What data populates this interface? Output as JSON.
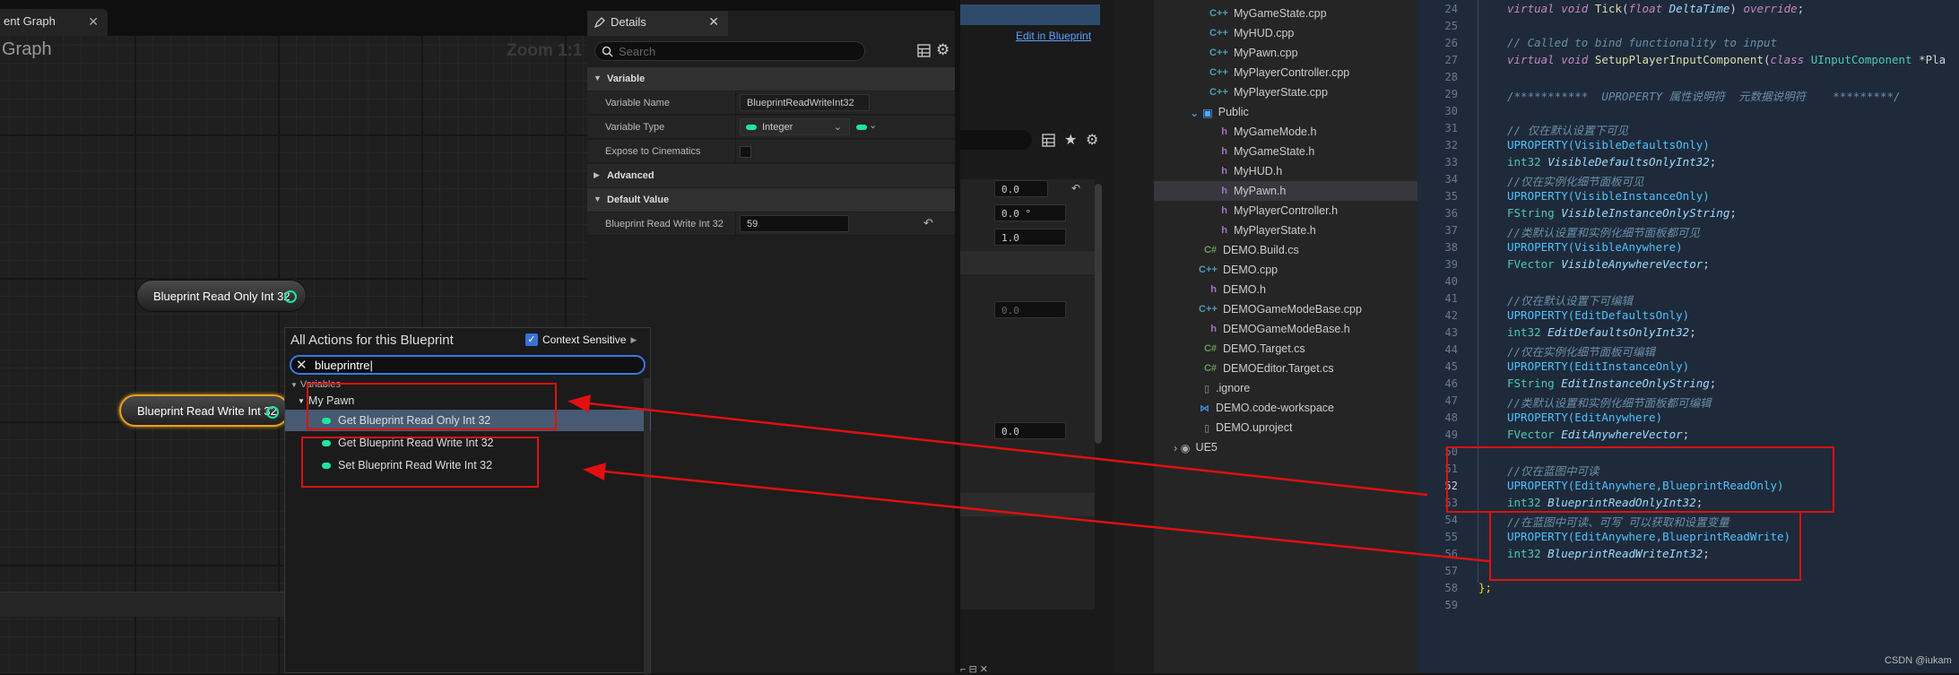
{
  "graph": {
    "tab_label": "ent Graph",
    "title": "Graph",
    "zoom": "Zoom 1:1",
    "nodes": {
      "read_only": "Blueprint Read Only Int 32",
      "read_write": "Blueprint Read Write Int 32"
    }
  },
  "details": {
    "tab_label": "Details",
    "search_placeholder": "Search",
    "sections": {
      "variable": "Variable",
      "advanced": "Advanced",
      "default_value": "Default Value"
    },
    "rows": {
      "variable_name_label": "Variable Name",
      "variable_name_value": "BlueprintReadWriteInt32",
      "variable_type_label": "Variable Type",
      "variable_type_value": "Integer",
      "expose_label": "Expose to Cinematics",
      "default_label": "Blueprint Read Write Int 32",
      "default_value": "59"
    }
  },
  "middle": {
    "edit_in_blueprint": "Edit in Blueprint",
    "fields": [
      "0.0",
      "0.0 °",
      "1.0",
      "0.0",
      "0.0"
    ]
  },
  "popup": {
    "title": "All Actions for this Blueprint",
    "context_sensitive": "Context Sensitive",
    "search_value": "blueprintre",
    "category": "Variables",
    "subcategory": "My Pawn",
    "items": [
      "Get Blueprint Read Only Int 32",
      "Get Blueprint Read Write Int 32",
      "Set Blueprint Read Write Int 32"
    ]
  },
  "file_tree": {
    "items": [
      {
        "icon": "C++",
        "name": "MyGameState.cpp"
      },
      {
        "icon": "C++",
        "name": "MyHUD.cpp"
      },
      {
        "icon": "C++",
        "name": "MyPawn.cpp"
      },
      {
        "icon": "C++",
        "name": "MyPlayerController.cpp"
      },
      {
        "icon": "C++",
        "name": "MyPlayerState.cpp"
      },
      {
        "icon": "folder",
        "name": "Public"
      },
      {
        "icon": "h",
        "name": "MyGameMode.h"
      },
      {
        "icon": "h",
        "name": "MyGameState.h"
      },
      {
        "icon": "h",
        "name": "MyHUD.h"
      },
      {
        "icon": "h",
        "name": "MyPawn.h"
      },
      {
        "icon": "h",
        "name": "MyPlayerController.h"
      },
      {
        "icon": "h",
        "name": "MyPlayerState.h"
      },
      {
        "icon": "C#",
        "name": "DEMO.Build.cs"
      },
      {
        "icon": "C++",
        "name": "DEMO.cpp"
      },
      {
        "icon": "h",
        "name": "DEMO.h"
      },
      {
        "icon": "C++",
        "name": "DEMOGameModeBase.cpp"
      },
      {
        "icon": "h",
        "name": "DEMOGameModeBase.h"
      },
      {
        "icon": "C#",
        "name": "DEMO.Target.cs"
      },
      {
        "icon": "C#",
        "name": "DEMOEditor.Target.cs"
      },
      {
        "icon": "file",
        "name": ".ignore"
      },
      {
        "icon": "vscode",
        "name": "DEMO.code-workspace"
      },
      {
        "icon": "file",
        "name": "DEMO.uproject"
      },
      {
        "icon": "folder",
        "name": "UE5"
      }
    ]
  },
  "code": {
    "line_numbers": [
      "24",
      "25",
      "26",
      "27",
      "28",
      "29",
      "30",
      "31",
      "32",
      "33",
      "34",
      "35",
      "36",
      "37",
      "38",
      "39",
      "40",
      "41",
      "42",
      "43",
      "44",
      "45",
      "46",
      "47",
      "48",
      "49",
      "50",
      "51",
      "52",
      "53",
      "54",
      "55",
      "56",
      "57",
      "58",
      "59"
    ],
    "lines": {
      "l24": "virtual void Tick(float DeltaTime) override;",
      "l26": "// Called to bind functionality to input",
      "l27": "virtual void SetupPlayerInputComponent(class UInputComponent *Pla",
      "l29": "/***********  UPROPERTY 属性说明符  元数据说明符    *********/",
      "l31": "// 仅在默认设置下可见",
      "l32": "UPROPERTY(VisibleDefaultsOnly)",
      "l33": "int32 VisibleDefaultsOnlyInt32;",
      "l34": "//仅在实例化细节面板可见",
      "l35": "UPROPERTY(VisibleInstanceOnly)",
      "l36": "FString VisibleInstanceOnlyString;",
      "l37": "//类默认设置和实例化细节面板都可见",
      "l38": "UPROPERTY(VisibleAnywhere)",
      "l39": "FVector VisibleAnywhereVector;",
      "l41": "//仅在默认设置下可编辑",
      "l42": "UPROPERTY(EditDefaultsOnly)",
      "l43": "int32 EditDefaultsOnlyInt32;",
      "l44": "//仅在实例化细节面板可编辑",
      "l45": "UPROPERTY(EditInstanceOnly)",
      "l46": "FString EditInstanceOnlyString;",
      "l47": "//类默认设置和实例化细节面板都可编辑",
      "l48": "UPROPERTY(EditAnywhere)",
      "l49": "FVector EditAnywhereVector;",
      "l51": "//仅在蓝图中可读",
      "l52": "UPROPERTY(EditAnywhere,BlueprintReadOnly)",
      "l53": "int32 BlueprintReadOnlyInt32;",
      "l54": "//在蓝图中可读、可写 可以获取和设置变量",
      "l55": "UPROPERTY(EditAnywhere,BlueprintReadWrite)",
      "l56": "int32 BlueprintReadWriteInt32;",
      "l58": "};"
    },
    "watermark": "CSDN @iukam"
  },
  "colors": {
    "annotation_red": "#e01010",
    "pin_green": "#1fe5a0",
    "selection_orange": "#e8a020"
  }
}
